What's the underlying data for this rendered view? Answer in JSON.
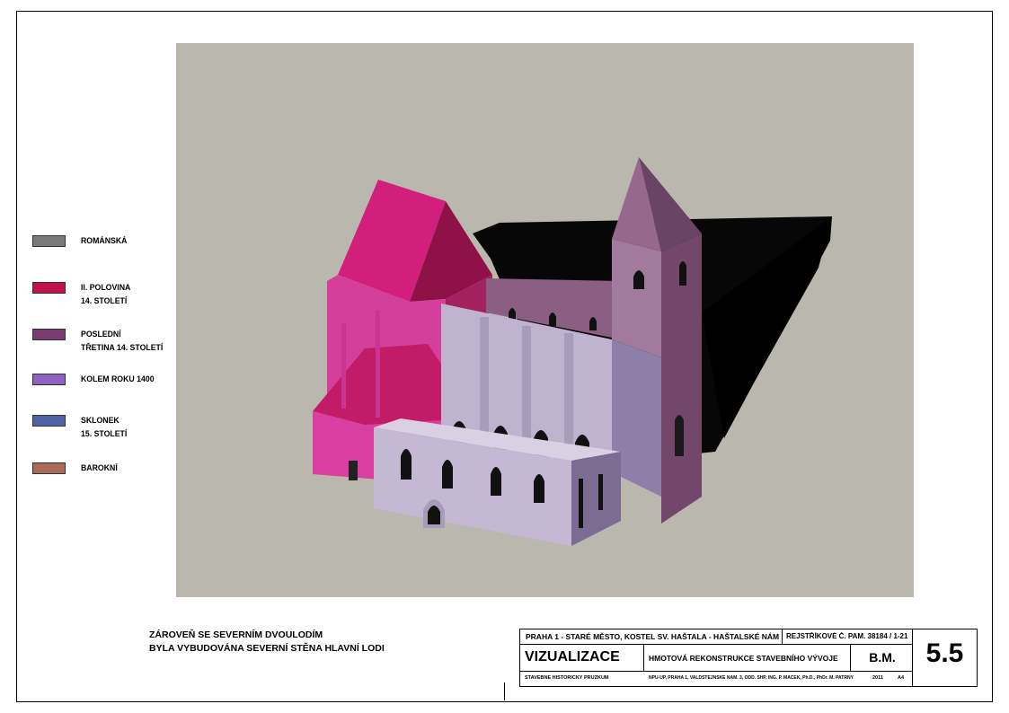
{
  "legend": [
    {
      "label": "ROMÁNSKÁ",
      "color": "#7b7a7a"
    },
    {
      "label": "II. POLOVINA\n14. STOLETÍ",
      "color": "#c0124d"
    },
    {
      "label": "POSLEDNÍ\nTŘETINA 14. STOLETÍ",
      "color": "#7a3a72"
    },
    {
      "label": "KOLEM ROKU 1400",
      "color": "#8d62c3"
    },
    {
      "label": "SKLONEK\n15. STOLETÍ",
      "color": "#4f63a6"
    },
    {
      "label": "BAROKNÍ",
      "color": "#a96a57"
    }
  ],
  "note": {
    "line1": "ZÁROVEŇ SE SEVERNÍM DVOULODÍM",
    "line2": "BYLA VYBUDOVÁNA  SEVERNÍ STĚNA HLAVNÍ LODI"
  },
  "title_block": {
    "location": "PRAHA 1 - STARÉ MĚSTO, KOSTEL SV. HAŠTALA - HAŠTALSKÉ NÁM.",
    "registry": "REJSTŘÍKOVÉ  Č. PAM.  38184 / 1-21",
    "drawing_type": "VIZUALIZACE",
    "drawing_title": "HMOTOVÁ REKONSTRUKCE STAVEBNÍHO VÝVOJE",
    "phase": "B.M.",
    "sheet_number": "5.5",
    "survey": "STAVEBNĚ HISTORICKÝ PRŮZKUM",
    "authors": "NPÚ-ÚP, PRAHA 1, VALDŠTEJNSKÉ NÁM. 3, ODD. SHP, ING. P. MACEK, Ph.D., PhDr. M. PATRNÝ",
    "year": "2011",
    "format": "A4"
  }
}
